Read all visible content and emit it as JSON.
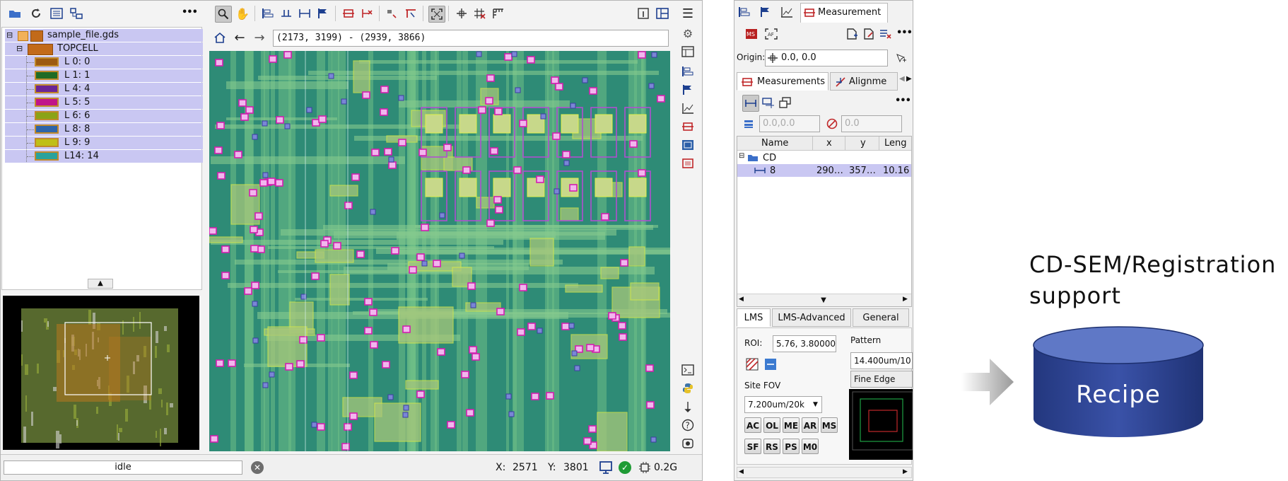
{
  "layout_panel": {
    "file_name": "sample_file.gds",
    "cell_name": "TOPCELL",
    "layers": [
      {
        "label": "L 0: 0",
        "color": "#9c5a12"
      },
      {
        "label": "L 1: 1",
        "color": "#1f6b24"
      },
      {
        "label": "L 4: 4",
        "color": "#6a2596"
      },
      {
        "label": "L 5: 5",
        "color": "#c0148a"
      },
      {
        "label": "L 6: 6",
        "color": "#8aa318"
      },
      {
        "label": "L 8: 8",
        "color": "#2f64a8"
      },
      {
        "label": "L 9: 9",
        "color": "#bfbf18"
      },
      {
        "label": "L14: 14",
        "color": "#2aa29c"
      }
    ],
    "more_label": "•••"
  },
  "viewer": {
    "coords_text": "(2173, 3199) - (2939, 3866)"
  },
  "status_bar": {
    "status": "idle",
    "x_label": "X:",
    "x_value": "2571",
    "y_label": "Y:",
    "y_value": "3801",
    "memory": "0.2G"
  },
  "measurement_panel": {
    "title_tab": "Measurement",
    "origin_label": "Origin:",
    "origin_value": "0.0, 0.0",
    "sub_tabs": [
      "Measurements",
      "Alignme"
    ],
    "more_label": "•••",
    "field1_placeholder": "0.0,0.0",
    "field2_placeholder": "0.0",
    "table": {
      "headers": [
        "Name",
        "x",
        "y",
        "Leng"
      ],
      "group": "CD",
      "rows": [
        {
          "name": "8",
          "x": "290…",
          "y": "357…",
          "length": "10.16"
        }
      ]
    },
    "bottom_tabs": [
      "LMS",
      "LMS-Advanced",
      "General"
    ],
    "roi_label": "ROI:",
    "roi_value": "5.76, 3.80000",
    "pattern_label": "Pattern",
    "pattern_value": "14.400um/10",
    "pattern_mode": "Fine Edge",
    "site_fov_label": "Site FOV",
    "site_fov_value": "7.200um/20k",
    "mode_buttons_row1": [
      "AC",
      "OL",
      "ME",
      "AR",
      "MS"
    ],
    "mode_buttons_row2": [
      "SF",
      "RS",
      "PS",
      "M0"
    ]
  },
  "diagram": {
    "caption_line1": "CD-SEM/Registration",
    "caption_line2": "support",
    "recipe_label": "Recipe"
  },
  "colors": {
    "selection": "#c9c7f2",
    "layout_bg": "#2e8b76",
    "recipe_blue": "#2b3f8c"
  }
}
